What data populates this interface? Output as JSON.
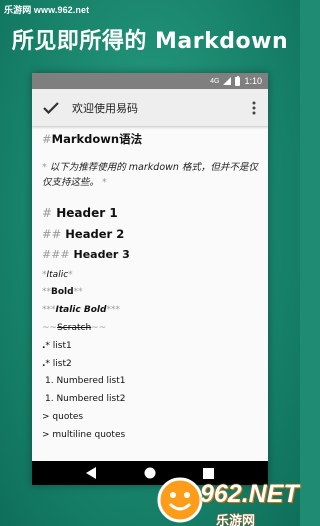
{
  "watermark_top": "乐游网 www.962.net",
  "headline": "所见即所得的 Markdown",
  "statusbar": {
    "time": "1:10",
    "network": "4G"
  },
  "toolbar": {
    "title": "欢迎使用易码"
  },
  "editor": {
    "heading_marker": "#",
    "heading_text": "Markdown语法",
    "para_marker_start": "*",
    "para_text": "以下为推荐使用的 markdown 格式，但并不是仅仅支持这些。",
    "para_marker_end": "*",
    "h1_marker": "#",
    "h1_text": "Header 1",
    "h2_marker": "##",
    "h2_text": "Header 2",
    "h3_marker": "###",
    "h3_text": "Header 3",
    "italic_marker": "*",
    "italic_text": "Italic",
    "bold_marker": "**",
    "bold_text": "Bold",
    "bolditalic_marker": "***",
    "bolditalic_text": "Italic Bold",
    "strike_marker": "~~",
    "strike_text": "Scratch",
    "list1_marker": "* ",
    "list1_text": "list1",
    "list2_marker": "* ",
    "list2_text": "list2",
    "num1_text": "1. Numbered list1",
    "num2_text": "1. Numbered list2",
    "quote1": "> quotes",
    "quote2": "> multiline quotes"
  },
  "watermark_bottom": {
    "logo": "962.NET",
    "sub": "乐游网"
  },
  "colors": {
    "background": "#1f8b72",
    "toolbar": "#eeeeee",
    "statusbar": "#7f7f7f",
    "navbar": "#000000"
  }
}
